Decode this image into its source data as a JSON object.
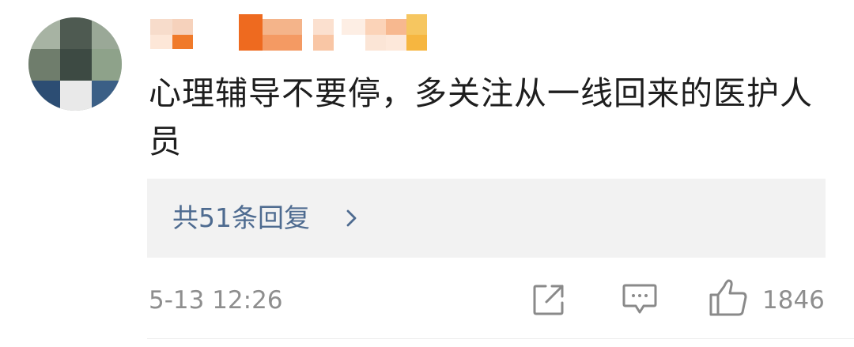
{
  "comment": {
    "text": "心理辅导不要停，多关注从一线回来的医护人员",
    "replies_link": "共51条回复",
    "timestamp": "5-13 12:26",
    "like_count": "1846"
  },
  "icons": {
    "replies": "chevron-right-icon",
    "share": "share-icon",
    "comment": "comment-icon",
    "like": "thumbs-up-icon"
  },
  "colors": {
    "link": "#4e6b90",
    "reply_bg": "#f2f2f2",
    "meta": "#8e8e8e",
    "text": "#1e1e1e"
  }
}
